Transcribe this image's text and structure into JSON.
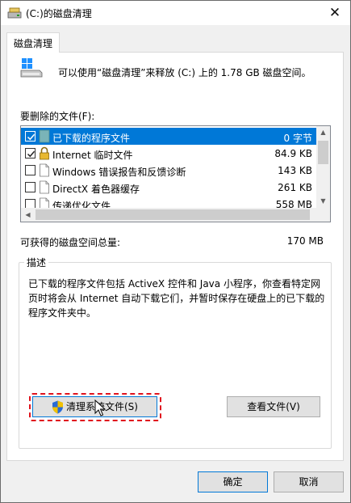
{
  "window": {
    "title": "(C:)的磁盘清理",
    "close_glyph": "✕",
    "title_icon": "disk-cleanup-icon"
  },
  "tab": {
    "label": "磁盘清理"
  },
  "info": {
    "text": "可以使用“磁盘清理”来释放  (C:) 上的 1.78 GB 磁盘空间。",
    "icon": "drive-icon"
  },
  "files": {
    "label": "要删除的文件(F):",
    "items": [
      {
        "checked": true,
        "selected": true,
        "name": "已下载的程序文件",
        "size": "0 字节",
        "icon": "folder-icon"
      },
      {
        "checked": true,
        "selected": false,
        "name": "Internet 临时文件",
        "size": "84.9 KB",
        "icon": "lock-icon"
      },
      {
        "checked": false,
        "selected": false,
        "name": "Windows 错误报告和反馈诊断",
        "size": "143 KB",
        "icon": "file-icon"
      },
      {
        "checked": false,
        "selected": false,
        "name": "DirectX 着色器缓存",
        "size": "261 KB",
        "icon": "file-icon"
      },
      {
        "checked": false,
        "selected": false,
        "name": "传递优化文件",
        "size": "558 MB",
        "icon": "file-icon"
      }
    ]
  },
  "space": {
    "label": "可获得的磁盘空间总量:",
    "value": "170 MB"
  },
  "description": {
    "title": "描述",
    "text": "已下载的程序文件包括 ActiveX 控件和 Java 小程序，你查看特定网页时将会从 Internet 自动下载它们，并暂时保存在硬盘上的已下载的程序文件夹中。"
  },
  "buttons": {
    "clean_system": "清理系统文件(S)",
    "view_files": "查看文件(V)",
    "ok": "确定",
    "cancel": "取消"
  },
  "colors": {
    "selection": "#0078d7",
    "highlight_ring": "#e0141e"
  }
}
